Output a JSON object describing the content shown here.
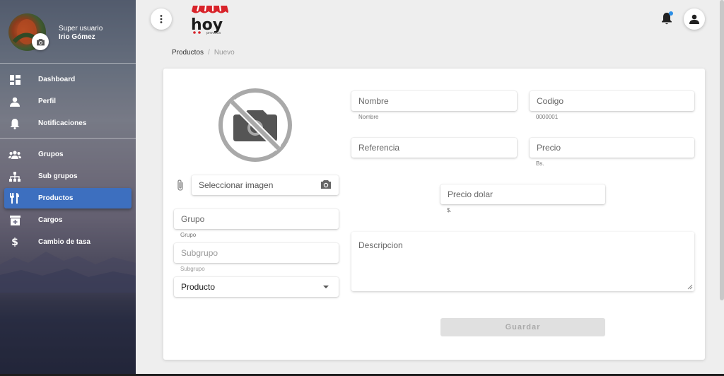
{
  "user": {
    "role": "Super usuario",
    "name": "Irio Gómez"
  },
  "sidebar": {
    "group1": [
      {
        "label": "Dashboard",
        "icon": "dashboard-icon"
      },
      {
        "label": "Perfil",
        "icon": "person-icon"
      },
      {
        "label": "Notificaciones",
        "icon": "bell-icon"
      }
    ],
    "group2": [
      {
        "label": "Grupos",
        "icon": "groups-icon"
      },
      {
        "label": "Sub grupos",
        "icon": "sitemap-icon"
      },
      {
        "label": "Productos",
        "icon": "utensils-icon",
        "active": true
      },
      {
        "label": "Cargos",
        "icon": "archive-plus-icon"
      },
      {
        "label": "Cambio de tasa",
        "icon": "dollar-icon"
      }
    ]
  },
  "header": {
    "logo_text": "hoy",
    "logo_sub": "provoca"
  },
  "breadcrumb": {
    "parent": "Productos",
    "separator": "/",
    "current": "Nuevo"
  },
  "form": {
    "image_select": "Seleccionar imagen",
    "grupo": {
      "label": "Grupo",
      "hint": "Grupo"
    },
    "subgrupo": {
      "label": "Subgrupo",
      "hint": "Subgrupo"
    },
    "tipo": {
      "value": "Producto"
    },
    "nombre": {
      "label": "Nombre",
      "hint": "Nombre"
    },
    "codigo": {
      "label": "Codigo",
      "hint": "0000001"
    },
    "referencia": {
      "label": "Referencia"
    },
    "precio": {
      "label": "Precio",
      "hint": "Bs."
    },
    "precio_dolar": {
      "label": "Precio dolar",
      "hint": "$."
    },
    "descripcion": {
      "label": "Descripcion"
    },
    "save_label": "Guardar"
  },
  "colors": {
    "accent": "#3d6fbf",
    "notification_dot": "#2b8ee6",
    "logo_red": "#d8232a"
  }
}
